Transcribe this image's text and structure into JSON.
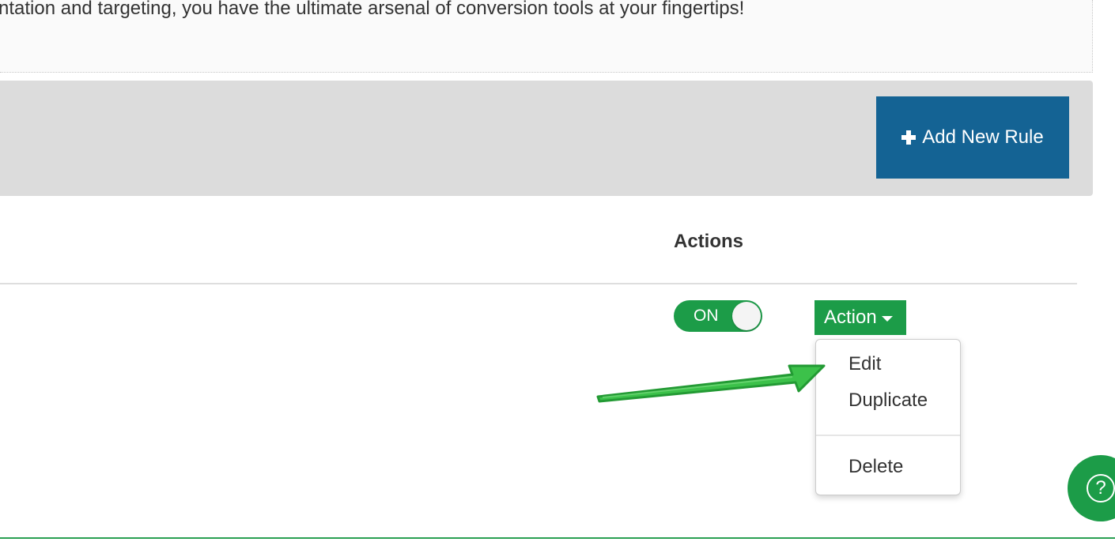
{
  "intro": {
    "text": "ntation and targeting, you have the ultimate arsenal of conversion tools at your fingertips!"
  },
  "toolbar": {
    "add_rule_label": "Add New Rule",
    "add_rule_icon": "plus-icon",
    "add_rule_color": "#146394"
  },
  "table": {
    "actions_header": "Actions",
    "row": {
      "toggle_label": "ON",
      "toggle_state": "on",
      "action_label": "Action",
      "action_icon": "caret-down-icon",
      "accent_color": "#1c9c48"
    }
  },
  "dropdown": {
    "items": [
      {
        "label": "Edit"
      },
      {
        "label": "Duplicate"
      },
      {
        "label": "Delete"
      }
    ]
  },
  "annotation": {
    "arrow_color": "#3cc14a",
    "arrow_icon": "arrow-right-icon"
  },
  "help": {
    "icon": "question-icon",
    "symbol": "?"
  }
}
